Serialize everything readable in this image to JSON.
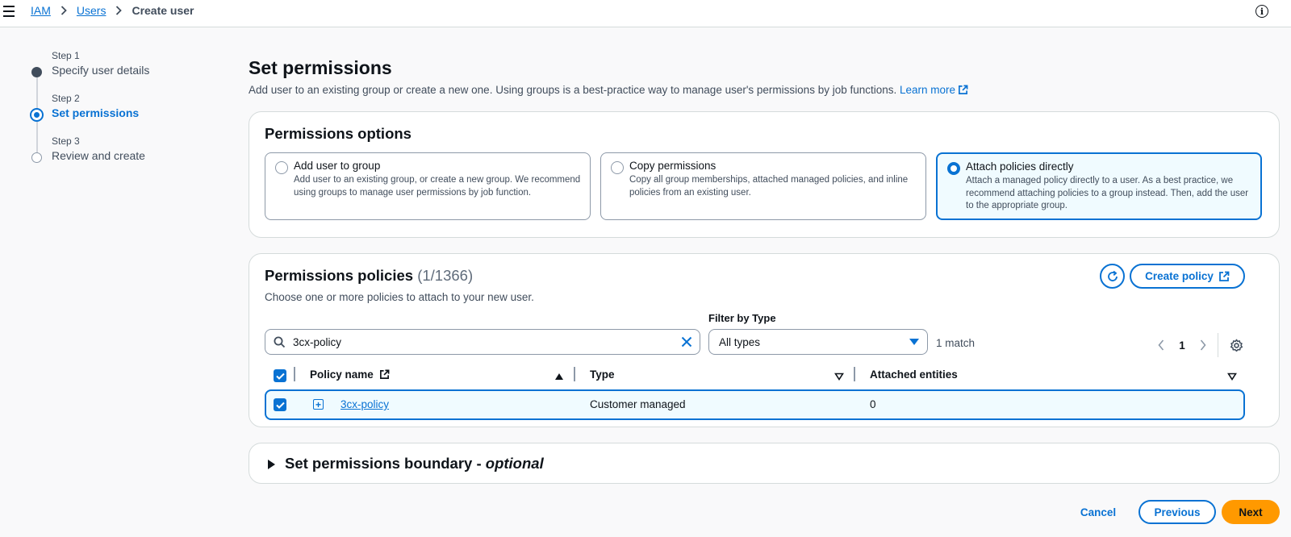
{
  "breadcrumb": {
    "items": [
      "IAM",
      "Users"
    ],
    "current": "Create user"
  },
  "steps": [
    {
      "number": "Step 1",
      "label": "Specify user details",
      "state": "complete"
    },
    {
      "number": "Step 2",
      "label": "Set permissions",
      "state": "active"
    },
    {
      "number": "Step 3",
      "label": "Review and create",
      "state": "pending"
    }
  ],
  "page": {
    "title": "Set permissions",
    "intro": "Add user to an existing group or create a new one. Using groups is a best-practice way to manage user's permissions by job functions.",
    "learn_more": "Learn more"
  },
  "permissions_options": {
    "title": "Permissions options",
    "options": [
      {
        "title": "Add user to group",
        "description": "Add user to an existing group, or create a new group. We recommend using groups to manage user permissions by job function.",
        "selected": false
      },
      {
        "title": "Copy permissions",
        "description": "Copy all group memberships, attached managed policies, and inline policies from an existing user.",
        "selected": false
      },
      {
        "title": "Attach policies directly",
        "description": "Attach a managed policy directly to a user. As a best practice, we recommend attaching policies to a group instead. Then, add the user to the appropriate group.",
        "selected": true
      }
    ]
  },
  "policies": {
    "title": "Permissions policies",
    "count": "(1/1366)",
    "subtitle": "Choose one or more policies to attach to your new user.",
    "create_policy": "Create policy",
    "filter_label": "Filter by Type",
    "search_value": "3cx-policy",
    "filter_value": "All types",
    "matches": "1 match",
    "page": "1",
    "columns": {
      "name": "Policy name",
      "type": "Type",
      "entities": "Attached entities"
    },
    "rows": [
      {
        "name": "3cx-policy",
        "type": "Customer managed",
        "entities": "0",
        "checked": true
      }
    ]
  },
  "boundary": {
    "title": "Set permissions boundary - ",
    "optional": "optional"
  },
  "footer": {
    "cancel": "Cancel",
    "previous": "Previous",
    "next": "Next"
  },
  "colors": {
    "accent": "#0972d3",
    "primary_button": "#ff9900",
    "selected_bg": "#f0fbff"
  }
}
